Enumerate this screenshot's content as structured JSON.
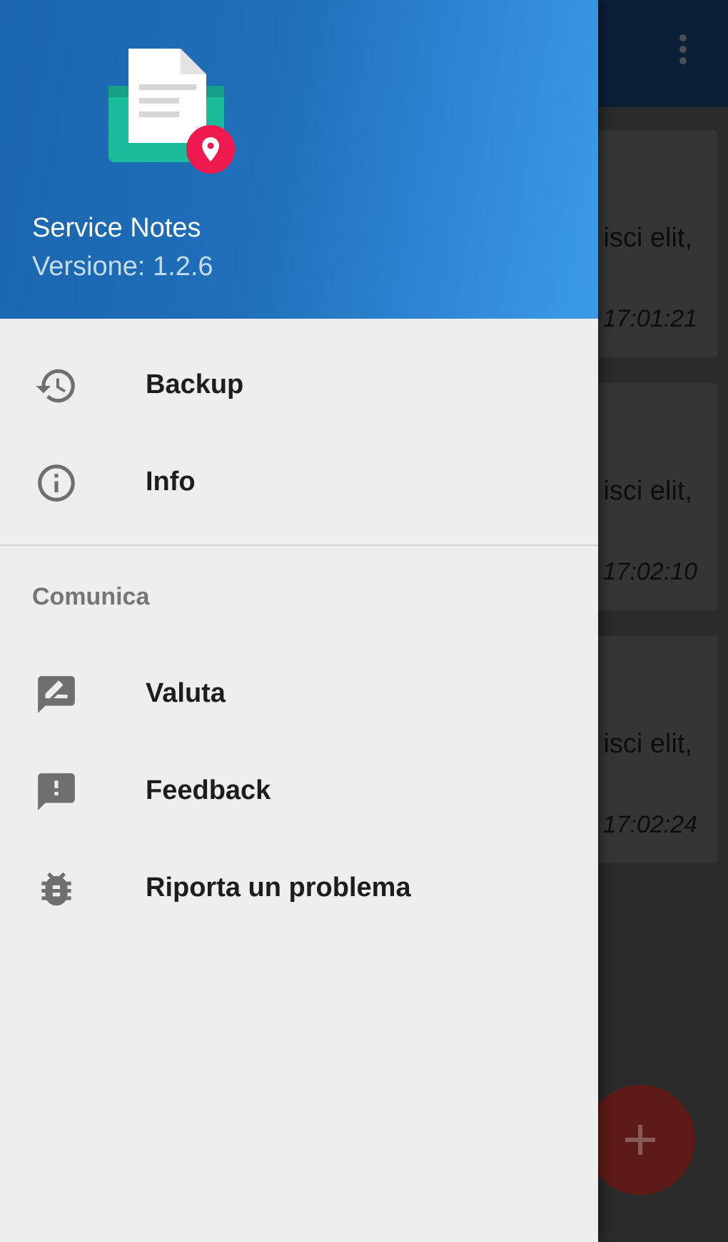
{
  "background": {
    "cards": [
      {
        "text": "isci elit,",
        "time": "17:01:21"
      },
      {
        "text": "isci elit,",
        "time": "17:02:10"
      },
      {
        "text": "isci elit,",
        "time": "17:02:24"
      }
    ],
    "fab_icon": "plus-icon",
    "more_icon": "more-vert-icon"
  },
  "drawer": {
    "header": {
      "app_name": "Service Notes",
      "version": "Versione: 1.2.6",
      "logo_icon": "notes-location-logo"
    },
    "items": [
      {
        "label": "Backup",
        "icon": "history-icon"
      },
      {
        "label": "Info",
        "icon": "info-icon"
      }
    ],
    "section_title": "Comunica",
    "section_items": [
      {
        "label": "Valuta",
        "icon": "rate-review-icon"
      },
      {
        "label": "Feedback",
        "icon": "feedback-icon"
      },
      {
        "label": "Riporta un problema",
        "icon": "bug-report-icon"
      }
    ]
  },
  "colors": {
    "header_start": "#1a65ad",
    "header_end": "#3c9be8",
    "drawer_bg": "#eeeeef",
    "fab": "#5e1a16",
    "logo_pin": "#f0194f",
    "logo_green": "#1abc9c"
  }
}
